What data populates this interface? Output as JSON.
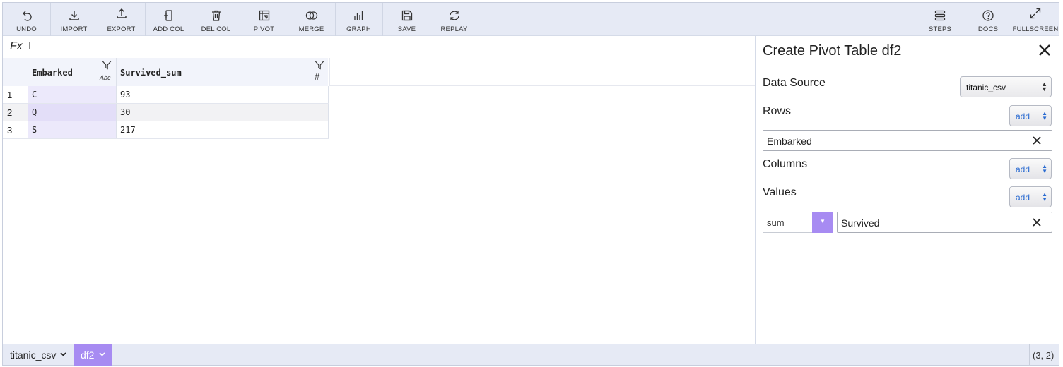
{
  "toolbar": {
    "left_groups": [
      [
        {
          "label": "UNDO",
          "icon": "undo-icon"
        }
      ],
      [
        {
          "label": "IMPORT",
          "icon": "import-icon"
        },
        {
          "label": "EXPORT",
          "icon": "export-icon"
        }
      ],
      [
        {
          "label": "ADD COL",
          "icon": "add-column-icon"
        },
        {
          "label": "DEL COL",
          "icon": "delete-column-icon"
        }
      ],
      [
        {
          "label": "PIVOT",
          "icon": "pivot-icon"
        },
        {
          "label": "MERGE",
          "icon": "merge-icon"
        }
      ],
      [
        {
          "label": "GRAPH",
          "icon": "graph-icon"
        }
      ],
      [
        {
          "label": "SAVE",
          "icon": "save-icon"
        },
        {
          "label": "REPLAY",
          "icon": "replay-icon"
        }
      ]
    ],
    "right": [
      {
        "label": "STEPS",
        "icon": "steps-icon"
      },
      {
        "label": "DOCS",
        "icon": "docs-icon"
      },
      {
        "label": "FULLSCREEN",
        "icon": "fullscreen-icon"
      }
    ]
  },
  "formula_bar": {
    "label": "Fx",
    "cursor": "I"
  },
  "table": {
    "columns": [
      {
        "name": "Embarked",
        "type": "Abc"
      },
      {
        "name": "Survived_sum",
        "type": "#"
      }
    ],
    "rows": [
      {
        "n": "1",
        "embarked": "C",
        "survived_sum": "93"
      },
      {
        "n": "2",
        "embarked": "Q",
        "survived_sum": "30"
      },
      {
        "n": "3",
        "embarked": "S",
        "survived_sum": "217"
      }
    ]
  },
  "panel": {
    "title": "Create Pivot Table df2",
    "data_source_label": "Data Source",
    "data_source_value": "titanic_csv",
    "rows_label": "Rows",
    "rows_add": "add",
    "rows_items": [
      "Embarked"
    ],
    "columns_label": "Columns",
    "columns_add": "add",
    "values_label": "Values",
    "values_add": "add",
    "values_agg": "sum",
    "values_items": [
      "Survived"
    ]
  },
  "footer": {
    "tabs": [
      {
        "label": "titanic_csv",
        "active": false
      },
      {
        "label": "df2",
        "active": true
      }
    ],
    "coords": "(3, 2)"
  },
  "colors": {
    "accent": "#a78bf2",
    "toolbar_bg": "#e6eaf5",
    "selected_col": "#ece9fb"
  }
}
